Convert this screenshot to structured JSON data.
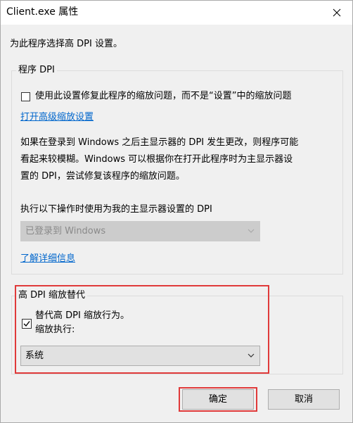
{
  "window": {
    "title": "Client.exe 属性"
  },
  "intro": "为此程序选择高 DPI 设置。",
  "program_dpi": {
    "legend": "程序 DPI",
    "checkbox_label": "使用此设置修复此程序的缩放问题，而不是“设置”中的缩放问题",
    "checkbox_checked": false,
    "advanced_link": "打开高级缩放设置",
    "description_lines": [
      "如果在登录到 Windows 之后主显示器的 DPI 发生更改，则程序可能",
      "看起来较模糊。Windows 可以根据你在打开此程序时为主显示器设",
      "置的 DPI，尝试修复该程序的缩放问题。"
    ],
    "select_label": "执行以下操作时使用为我的主显示器设置的 DPI",
    "select_value": "已登录到 Windows",
    "learn_more_link": "了解详细信息"
  },
  "high_dpi_override": {
    "legend": "高 DPI 缩放替代",
    "checkbox_label": "替代高 DPI 缩放行为。",
    "checkbox_checked": true,
    "sub_label": "缩放执行:",
    "select_value": "系统"
  },
  "buttons": {
    "ok": "确定",
    "cancel": "取消"
  },
  "colors": {
    "link": "#0066cc",
    "highlight_border": "#e03a3a",
    "dialog_bg": "#f0f0f0"
  }
}
